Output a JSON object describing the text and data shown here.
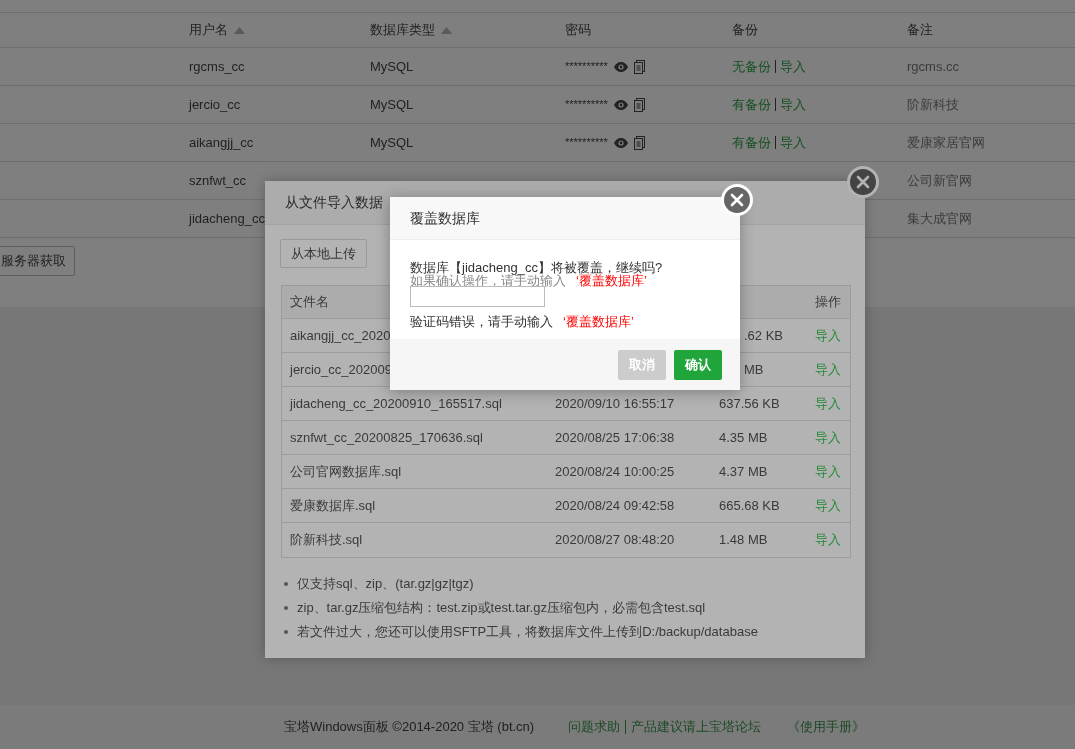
{
  "page_table": {
    "columns": [
      {
        "label": "用户名",
        "sortable": true
      },
      {
        "label": "数据库类型",
        "sortable": true
      },
      {
        "label": "密码",
        "sortable": false
      },
      {
        "label": "备份",
        "sortable": false
      },
      {
        "label": "备注",
        "sortable": false
      }
    ],
    "rows": [
      {
        "username": "rgcms_cc",
        "type": "MySQL",
        "password": "**********",
        "backup_status": "无备份",
        "backup_action": "导入",
        "remark": "rgcms.cc"
      },
      {
        "username": "jercio_cc",
        "type": "MySQL",
        "password": "**********",
        "backup_status": "有备份",
        "backup_action": "导入",
        "remark": "阶新科技"
      },
      {
        "username": "aikangjj_cc",
        "type": "MySQL",
        "password": "**********",
        "backup_status": "有备份",
        "backup_action": "导入",
        "remark": "爱康家居官网"
      },
      {
        "username": "sznfwt_cc",
        "remark": "公司新官网"
      },
      {
        "username": "jidacheng_cc",
        "remark": "集大成官网"
      }
    ]
  },
  "server_button": "服务器获取",
  "import_dialog": {
    "title": "从文件导入数据",
    "upload_button": "从本地上传",
    "header": {
      "name": "文件名",
      "action": "操作"
    },
    "files": [
      {
        "name": "aikangjj_cc_2020",
        "size": ".62 KB",
        "action": "导入"
      },
      {
        "name": "jercio_cc_202009",
        "size": "MB",
        "action": "导入"
      },
      {
        "name": "jidacheng_cc_20200910_165517.sql",
        "time": "2020/09/10 16:55:17",
        "size": "637.56 KB",
        "action": "导入"
      },
      {
        "name": "sznfwt_cc_20200825_170636.sql",
        "time": "2020/08/25 17:06:38",
        "size": "4.35 MB",
        "action": "导入"
      },
      {
        "name": "公司官网数据库.sql",
        "time": "2020/08/24 10:00:25",
        "size": "4.37 MB",
        "action": "导入"
      },
      {
        "name": "爱康数据库.sql",
        "time": "2020/08/24 09:42:58",
        "size": "665.68 KB",
        "action": "导入"
      },
      {
        "name": "阶新科技.sql",
        "time": "2020/08/27 08:48:20",
        "size": "1.48 MB",
        "action": "导入"
      }
    ],
    "notes": [
      "仅支持sql、zip、(tar.gz|gz|tgz)",
      "zip、tar.gz压缩包结构：test.zip或test.tar.gz压缩包内，必需包含test.sql",
      "若文件过大，您还可以使用SFTP工具，将数据库文件上传到D:/backup/database"
    ]
  },
  "confirm_dialog": {
    "title": "覆盖数据库",
    "message": "数据库【jidacheng_cc】将被覆盖，继续吗?",
    "hint": "如果确认操作，请手动输入",
    "hint_code": "‘覆盖数据库’",
    "error": "验证码错误，请手动输入",
    "error_code": "‘覆盖数据库’",
    "buttons": [
      {
        "label": "取消",
        "kind": "cancel"
      },
      {
        "label": "确认",
        "kind": "confirm"
      }
    ]
  },
  "footer": {
    "copyright": "宝塔Windows面板 ©2014-2020 宝塔 (bt.cn)",
    "links": [
      "问题求助",
      "产品建议请上宝塔论坛"
    ],
    "manual": "《使用手册》"
  }
}
